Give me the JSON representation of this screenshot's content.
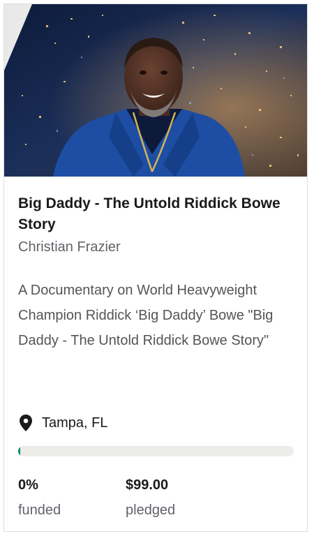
{
  "project": {
    "title": "Big Daddy - The Untold Riddick Bowe Story",
    "creator": "Christian Frazier",
    "blurb": "A Documentary on World Heavyweight Champion Riddick ‘Big Daddy’ Bowe \"Big Daddy - The Untold Riddick Bowe Story\"",
    "location": "Tampa, FL",
    "funded_fraction": 0.0,
    "stats": {
      "funded_value": "0%",
      "funded_label": "funded",
      "pledged_value": "$99.00",
      "pledged_label": "pledged"
    }
  },
  "colors": {
    "progress_fill": "#0f8a65",
    "progress_track": "#ecece9",
    "jacket": "#1d4ea3"
  },
  "icons": {
    "location": "map-pin-icon"
  }
}
